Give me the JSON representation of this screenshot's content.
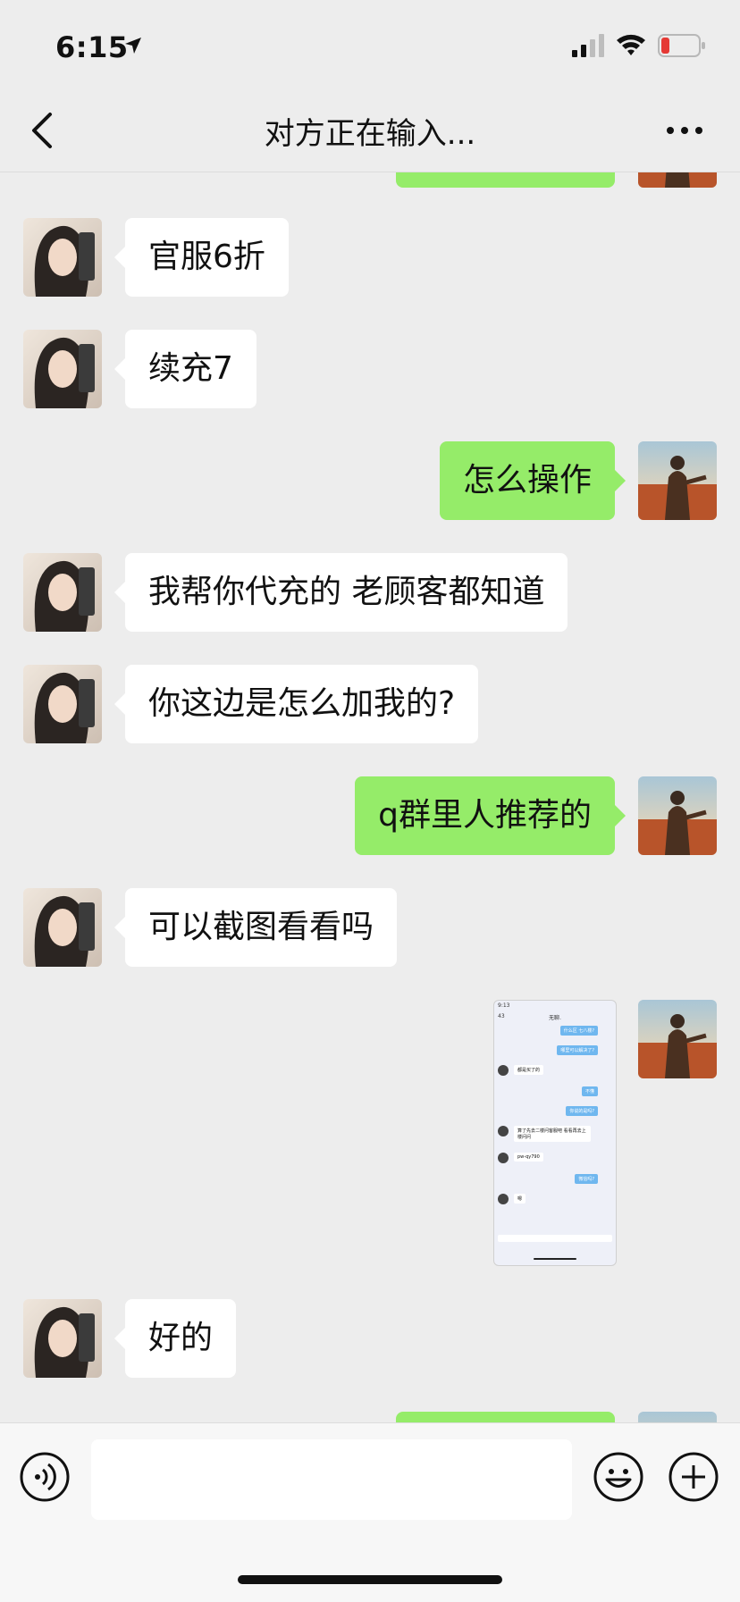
{
  "status_bar": {
    "time": "6:15"
  },
  "nav": {
    "title": "对方正在输入..."
  },
  "messages": [
    {
      "side": "left",
      "text": "官服6折"
    },
    {
      "side": "left",
      "text": "续充7"
    },
    {
      "side": "right",
      "text": "怎么操作"
    },
    {
      "side": "left",
      "text": "我帮你代充的 老顾客都知道"
    },
    {
      "side": "left",
      "text": "你这边是怎么加我的?"
    },
    {
      "side": "right",
      "text": "q群里人推荐的"
    },
    {
      "side": "left",
      "text": "可以截图看看吗"
    },
    {
      "side": "right",
      "type": "image"
    },
    {
      "side": "left",
      "text": "好的"
    }
  ],
  "screenshot_thumb": {
    "time": "9:13",
    "back_count": "43",
    "title": "无聊.",
    "lines": [
      "什么区 七八楼?",
      "哪里可以解决了?",
      "都是买了的",
      "不懂",
      "你说的是吗?",
      "算了先去二楼问客服吧 看看再去上楼问问",
      "pw-qy790",
      "微信吗?",
      "嗯"
    ]
  },
  "colors": {
    "self_bubble": "#95ec69",
    "other_bubble": "#ffffff",
    "background": "#ededed"
  }
}
